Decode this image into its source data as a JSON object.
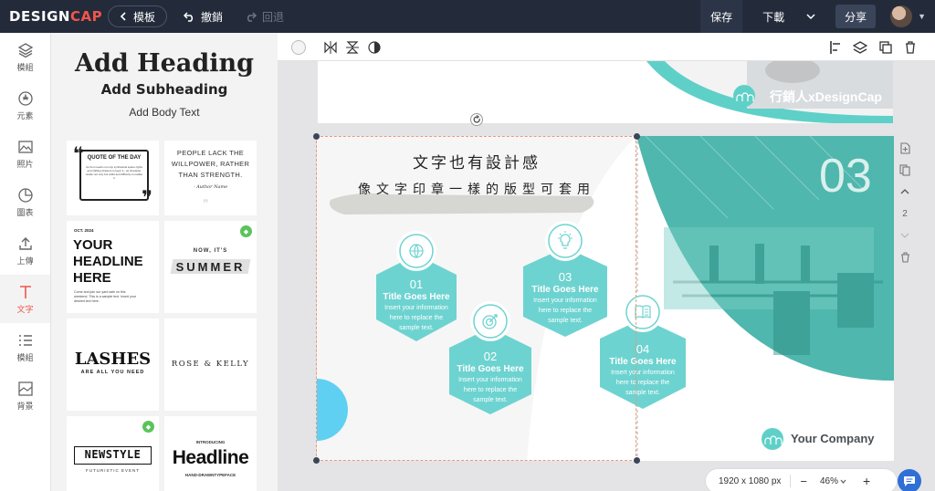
{
  "topbar": {
    "logo_design": "DESIGN",
    "logo_cap": "CAP",
    "templates_label": "模板",
    "undo_label": "撤銷",
    "redo_label": "回退",
    "save_label": "保存",
    "download_label": "下載",
    "share_label": "分享"
  },
  "rail": {
    "items": [
      {
        "label": "模組",
        "icon": "layers-icon"
      },
      {
        "label": "元素",
        "icon": "shapes-icon"
      },
      {
        "label": "照片",
        "icon": "photo-icon"
      },
      {
        "label": "圖表",
        "icon": "chart-icon"
      },
      {
        "label": "上傳",
        "icon": "upload-icon"
      },
      {
        "label": "文字",
        "icon": "text-icon"
      },
      {
        "label": "模組",
        "icon": "list-icon"
      },
      {
        "label": "背景",
        "icon": "background-icon"
      }
    ]
  },
  "panel": {
    "add_heading": "Add Heading",
    "add_subheading": "Add Subheading",
    "add_body": "Add Body Text",
    "cards": {
      "quote_title": "QUOTE OF THE DAY",
      "quote_text": "Au font needs not only synthetical space rights and shifting drawers to layer it - as character reside not only but artful and difficulty to realise it",
      "people_text": "PEOPLE LACK THE WILLPOWER, RATHER THAN STRENGTH.",
      "people_author": "- Author Name",
      "oct": "OCT. 2024",
      "your_headline": "YOUR HEADLINE HERE",
      "headline_body": "Come and join our yard sale on this weekend. This is a sample text. Insert your desired text here.",
      "now_its": "NOW, IT'S",
      "summer": "SUMMER",
      "lashes": "LASHES",
      "lashes_sub": "ARE ALL YOU NEED",
      "rose_kelly": "ROSE & KELLY",
      "newstyle": "NEWSTYLE",
      "newstyle_sub": "FUTURISTIC EVENT",
      "introducing": "INTRODUCING",
      "headline": "Headline",
      "headline_sub": "HAND-DRAWNTYPEFACE"
    }
  },
  "canvas": {
    "prev_brand": "行銷人xDesignCap",
    "title_line1": "文字也有設計感",
    "title_line2": "像文字印章一樣的版型可套用",
    "big_number": "03",
    "company": "Your Company",
    "items": [
      {
        "num": "01",
        "title": "Title Goes Here",
        "l1": "Insert your information",
        "l2": "here to replace the",
        "l3": "sample text."
      },
      {
        "num": "02",
        "title": "Title Goes Here",
        "l1": "Insert your information",
        "l2": "here to replace the",
        "l3": "sample text."
      },
      {
        "num": "03",
        "title": "Title Goes Here",
        "l1": "Insert your information",
        "l2": "here to replace the",
        "l3": "sample text."
      },
      {
        "num": "04",
        "title": "Title Goes Here",
        "l1": "Insert your information",
        "l2": "here to replace the",
        "l3": "sample text."
      }
    ]
  },
  "side_tools": {
    "page_number": "2"
  },
  "zoombar": {
    "dimensions": "1920 x 1080 px",
    "minus": "−",
    "zoom": "46%",
    "plus": "+"
  },
  "colors": {
    "teal": "#5fd0c8",
    "accent": "#f2554b",
    "topbar": "#232b3b"
  }
}
